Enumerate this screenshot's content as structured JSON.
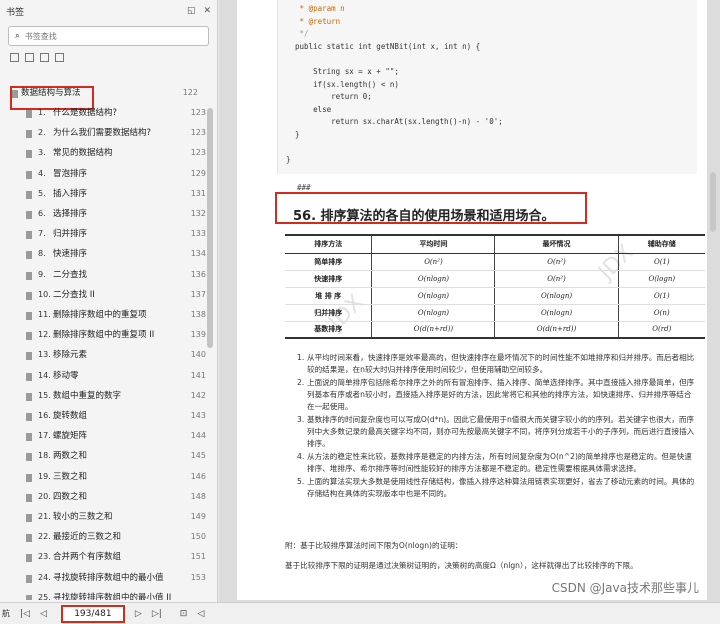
{
  "sidebar": {
    "title": "书签",
    "search_placeholder": "书签查找",
    "root_item": "数据结构与算法",
    "root_page": "122",
    "items": [
      {
        "num": "1.",
        "title": "什么是数据结构?",
        "page": "123"
      },
      {
        "num": "2.",
        "title": "为什么我们需要数据结构?",
        "page": "123"
      },
      {
        "num": "3.",
        "title": "常见的数据结构",
        "page": "123"
      },
      {
        "num": "4.",
        "title": "冒泡排序",
        "page": "129"
      },
      {
        "num": "5.",
        "title": "插入排序",
        "page": "131"
      },
      {
        "num": "6.",
        "title": "选择排序",
        "page": "132"
      },
      {
        "num": "7.",
        "title": "归并排序",
        "page": "133"
      },
      {
        "num": "8.",
        "title": "快速排序",
        "page": "134"
      },
      {
        "num": "9.",
        "title": "二分查找",
        "page": "136"
      },
      {
        "num": "10.",
        "title": "二分查找 II",
        "page": "137"
      },
      {
        "num": "11.",
        "title": "删除排序数组中的重复项",
        "page": "138"
      },
      {
        "num": "12.",
        "title": "删除排序数组中的重复项 II",
        "page": "139"
      },
      {
        "num": "13.",
        "title": "移除元素",
        "page": "140"
      },
      {
        "num": "14.",
        "title": "移动零",
        "page": "141"
      },
      {
        "num": "15.",
        "title": "数组中重复的数字",
        "page": "142"
      },
      {
        "num": "16.",
        "title": "旋转数组",
        "page": "143"
      },
      {
        "num": "17.",
        "title": "螺旋矩阵",
        "page": "144"
      },
      {
        "num": "18.",
        "title": "两数之和",
        "page": "145"
      },
      {
        "num": "19.",
        "title": "三数之和",
        "page": "146"
      },
      {
        "num": "20.",
        "title": "四数之和",
        "page": "148"
      },
      {
        "num": "21.",
        "title": "较小的三数之和",
        "page": "149"
      },
      {
        "num": "22.",
        "title": "最接近的三数之和",
        "page": "150"
      },
      {
        "num": "23.",
        "title": "合并两个有序数组",
        "page": "151"
      },
      {
        "num": "24.",
        "title": "寻找旋转排序数组中的最小值",
        "page": "153"
      },
      {
        "num": "25.",
        "title": "寻找旋转排序数组中的最小值 II",
        "page": ""
      }
    ]
  },
  "bottom": {
    "label": "航",
    "page_indicator": "193/481"
  },
  "document": {
    "code": [
      {
        "text": "   * @param n",
        "cls": "an"
      },
      {
        "text": "   * @return",
        "cls": "an"
      },
      {
        "text": "   */",
        "cls": "cm"
      },
      {
        "text": "  public static int getNBit(int x, int n) {",
        "cls": ""
      },
      {
        "text": "",
        "cls": ""
      },
      {
        "text": "      String sx = x + \"\";",
        "cls": ""
      },
      {
        "text": "      if(sx.length() < n)",
        "cls": ""
      },
      {
        "text": "          return 0;",
        "cls": ""
      },
      {
        "text": "      else",
        "cls": ""
      },
      {
        "text": "          return sx.charAt(sx.length()-n) - '0';",
        "cls": ""
      },
      {
        "text": "  }",
        "cls": ""
      },
      {
        "text": "",
        "cls": ""
      },
      {
        "text": "}",
        "cls": ""
      }
    ],
    "hash": "###",
    "heading": "56. 排序算法的各自的使用场景和适用场合。",
    "table": {
      "headers": [
        "排序方法",
        "平均时间",
        "最坏情况",
        "辅助存储"
      ],
      "rows": [
        [
          "简单排序",
          "O(n²)",
          "O(n²)",
          "O(1)"
        ],
        [
          "快速排序",
          "O(nlogn)",
          "O(n²)",
          "O(logn)"
        ],
        [
          "堆 排 序",
          "O(nlogn)",
          "O(nlogn)",
          "O(1)"
        ],
        [
          "归并排序",
          "O(nlogn)",
          "O(nlogn)",
          "O(n)"
        ],
        [
          "基数排序",
          "O(d(n+rd))",
          "O(d(n+rd))",
          "O(rd)"
        ]
      ]
    },
    "notes": [
      "从平均时间来看，快速排序是效率最高的，但快速排序在最坏情况下的时间性能不如堆排序和归并排序。而后者相比较的结果是，在n较大时归并排序使用时间较少，但使用辅助空间较多。",
      "上面说的简单排序包括除希尔排序之外的所有冒泡排序、插入排序、简单选择排序。其中直接插入排序最简单，但序列基本有序或者n较小时，直接插入排序是好的方法，因此常将它和其他的排序方法，如快速排序、归并排序等结合在一起使用。",
      "基数排序的时间复杂度也可以写成O(d*n)。因此它最使用于n值很大而关键字较小的的序列。若关键字也很大，而序列中大多数记录的最高关键字均不同，则亦可先按最高关键字不同，将序列分成若干小的子序列，而后进行直接插入排序。",
      "从方法的稳定性来比较，基数排序是稳定的内排方法，所有时间复杂度为O(n^2)的简单排序也是稳定的。但是快速排序、堆排序、希尔排序等时间性能较好的排序方法都是不稳定的。稳定性需要根据具体需求选择。",
      "上面的算法实现大多数是使用线性存储结构，像插入排序这种算法用链表实现更好，省去了移动元素的时间。具体的存储结构在具体的实现版本中也是不同的。"
    ],
    "proof_title": "附：基于比较排序算法时间下限为O(nlogn)的证明：",
    "proof_body": "基于比较排序下限的证明是通过决策树证明的，决策树的高度Ω（nlgn），这样就得出了比较排序的下限。",
    "credit": "CSDN @Java技术那些事儿"
  }
}
